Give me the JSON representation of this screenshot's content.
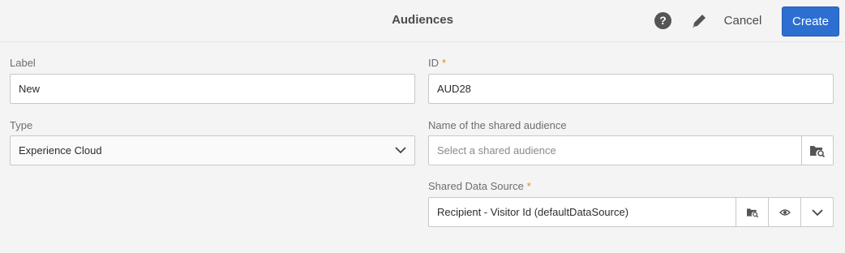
{
  "header": {
    "title": "Audiences",
    "help_icon": "?",
    "cancel_label": "Cancel",
    "create_label": "Create"
  },
  "form": {
    "label": {
      "label": "Label",
      "value": "New"
    },
    "id": {
      "label": "ID",
      "required_mark": "*",
      "value": "AUD28"
    },
    "type": {
      "label": "Type",
      "value": "Experience Cloud"
    },
    "shared_audience": {
      "label": "Name of the shared audience",
      "placeholder": "Select a shared audience"
    },
    "data_source": {
      "label": "Shared Data Source",
      "required_mark": "*",
      "value": "Recipient - Visitor Id (defaultDataSource)"
    }
  },
  "icons": {
    "help": "help-icon",
    "edit": "pencil-icon",
    "browse": "folder-search-icon",
    "view": "eye-icon",
    "dropdown": "chevron-down-icon"
  },
  "colors": {
    "accent": "#2d6fd0",
    "required": "#e68619"
  }
}
